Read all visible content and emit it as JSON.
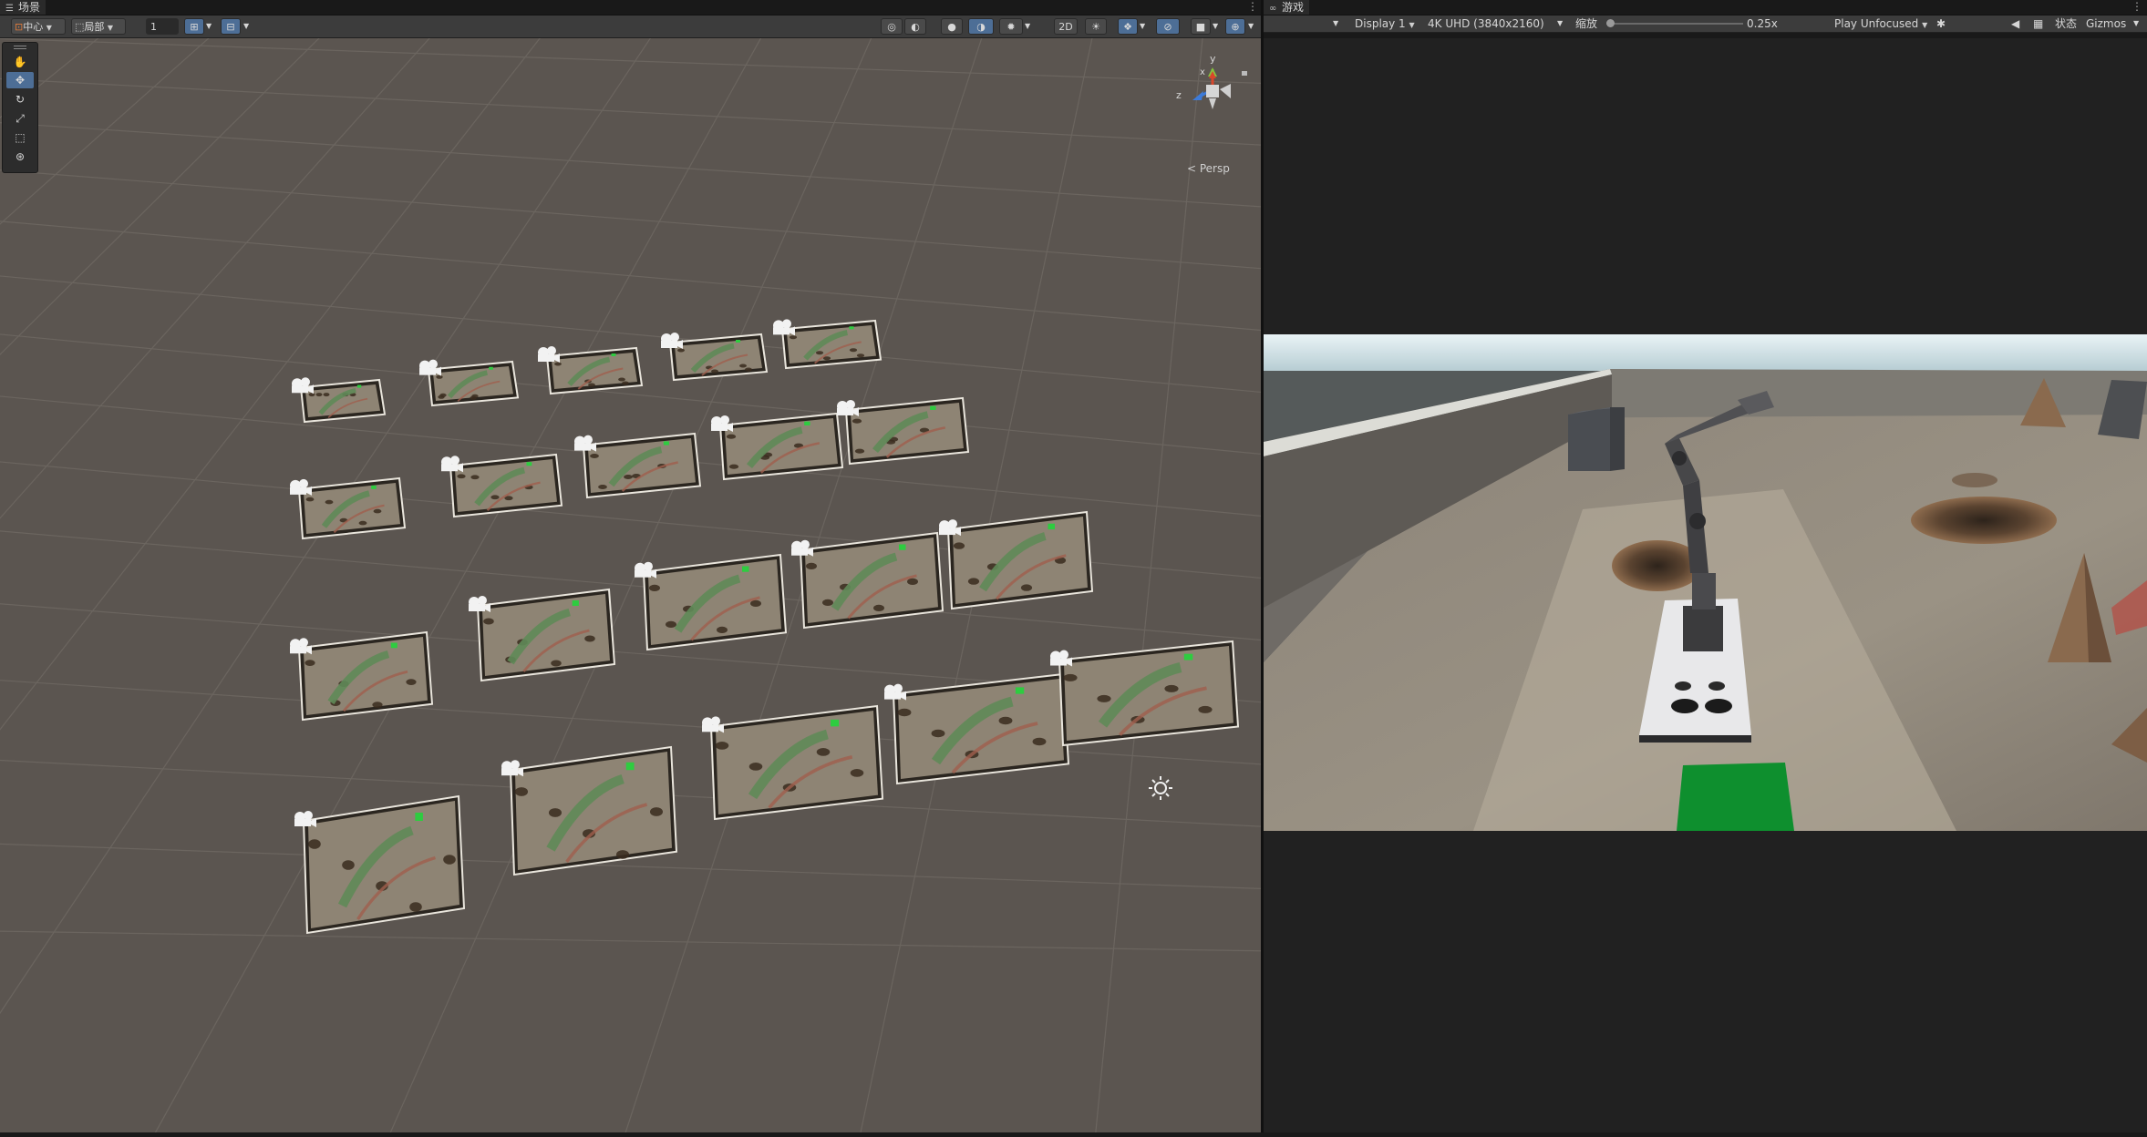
{
  "scene_panel": {
    "tab_label": "场景",
    "tab_icon": "menu-icon",
    "toolbar": {
      "pivot_label": "中心",
      "space_label": "局部",
      "snap_value": "1",
      "mode_2d_label": "2D"
    },
    "tools": [
      "hand-tool",
      "move-tool",
      "rotate-tool",
      "scale-tool",
      "rect-tool",
      "transform-tool"
    ],
    "active_tool": "move-tool",
    "gizmo": {
      "axis_y": "y",
      "axis_x": "x",
      "axis_z": "z",
      "view_label": "< Persp"
    },
    "environments": {
      "rows": 4,
      "per_row": 5
    }
  },
  "game_panel": {
    "tab_label": "游戏",
    "tab_icon": "gamepad-icon",
    "toolbar": {
      "display_label": "Display 1",
      "resolution_label": "4K UHD (3840x2160)",
      "scale_label": "缩放",
      "scale_value": "0.25x",
      "scale_fraction": 0.0,
      "play_mode_label": "Play Unfocused",
      "stats_label": "状态",
      "gizmos_label": "Gizmos"
    }
  },
  "colors": {
    "accent": "#4d6e96",
    "scene_bg": "#5b5550",
    "panel_bg": "#212121",
    "toolbar_bg": "#3c3c3c",
    "target_green": "#0e8f2e"
  }
}
